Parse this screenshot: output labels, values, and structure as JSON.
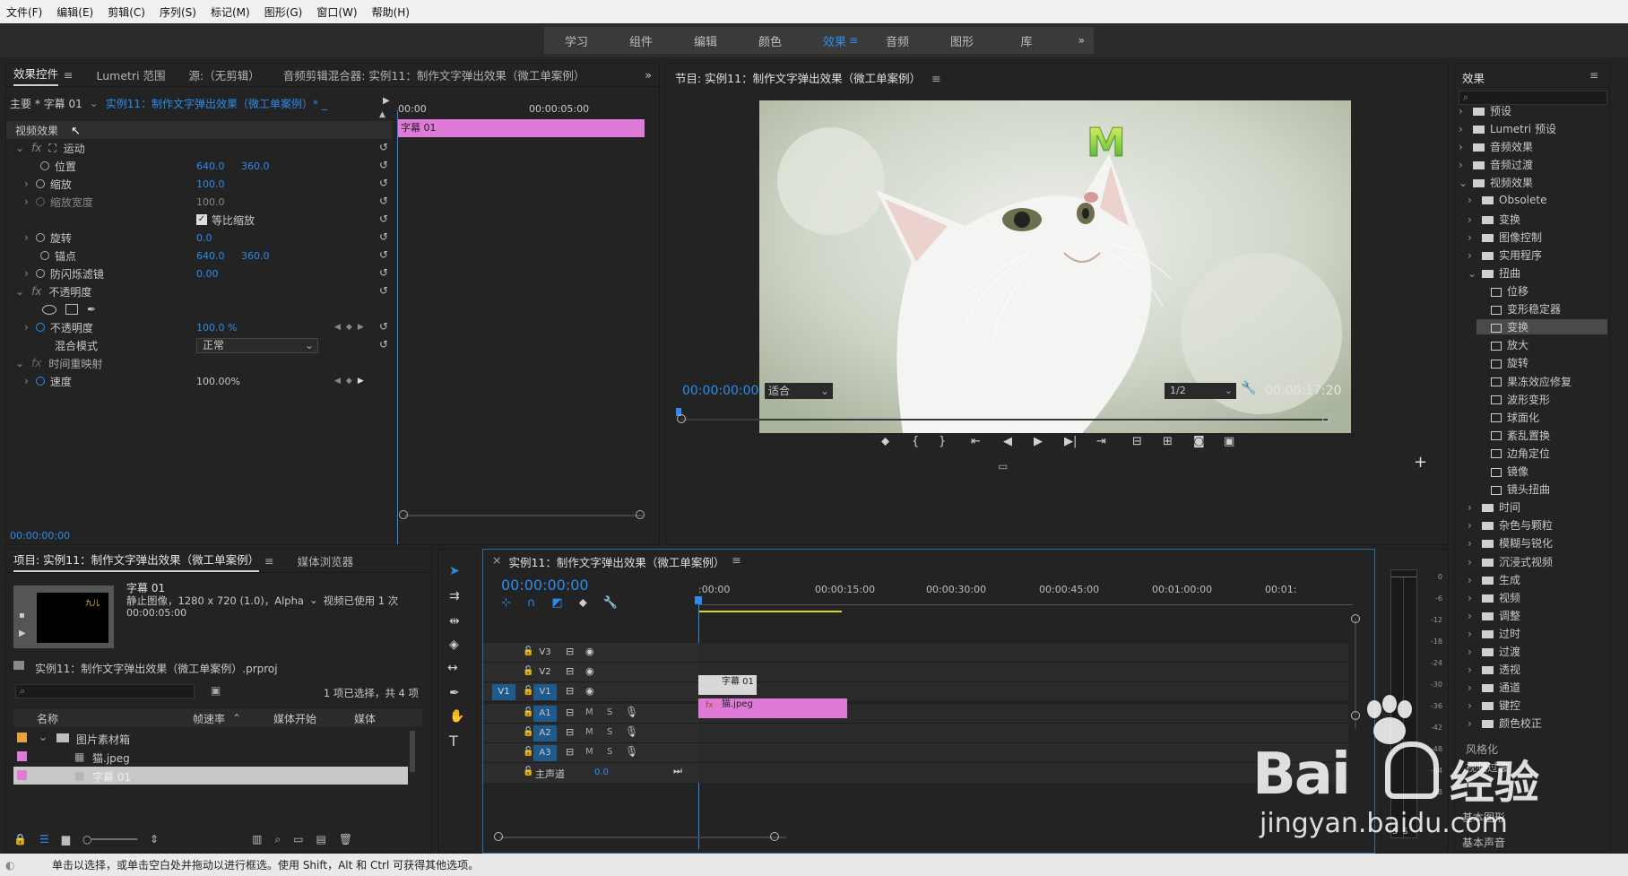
{
  "menubar": [
    "文件(F)",
    "编辑(E)",
    "剪辑(C)",
    "序列(S)",
    "标记(M)",
    "图形(G)",
    "窗口(W)",
    "帮助(H)"
  ],
  "workspaces": {
    "items": [
      "学习",
      "组件",
      "编辑",
      "颜色",
      "效果",
      "音频",
      "图形",
      "库"
    ],
    "active": "效果",
    "more": "»"
  },
  "effect_controls": {
    "tabs": [
      "效果控件",
      "Lumetri 范围",
      "源:（无剪辑）",
      "音频剪辑混合器: 实例11：制作文字弹出效果（微工单案例）"
    ],
    "master_label": "主要 * 字幕 01",
    "sequence_label": "实例11：制作文字弹出效果（微工单案例）* _",
    "ruler_start": "00:00",
    "ruler_end": "00:00:05:00",
    "clip_label": "字幕 01",
    "section": "视频效果",
    "motion": "运动",
    "position_label": "位置",
    "position_x": "640.0",
    "position_y": "360.0",
    "scale_label": "缩放",
    "scale_value": "100.0",
    "scale_width_label": "缩放宽度",
    "scale_width_value": "100.0",
    "uniform_label": "等比缩放",
    "rotation_label": "旋转",
    "rotation_value": "0.0",
    "anchor_label": "锚点",
    "anchor_x": "640.0",
    "anchor_y": "360.0",
    "flicker_label": "防闪烁滤镜",
    "flicker_value": "0.00",
    "opacity_section": "不透明度",
    "opacity_label": "不透明度",
    "opacity_value": "100.0 %",
    "blend_label": "混合模式",
    "blend_value": "正常",
    "time_remap": "时间重映射",
    "speed_label": "速度",
    "speed_value": "100.00%",
    "timecode": "00:00:00:00"
  },
  "program": {
    "title": "节目: 实例11：制作文字弹出效果（微工单案例）",
    "overlay_letter": "M",
    "timecode": "00:00:00:00",
    "fit": "适合",
    "resolution": "1/2",
    "duration": "00:00:17:20"
  },
  "effects": {
    "title": "效果",
    "search_placeholder": "",
    "items": [
      {
        "label": "预设",
        "level": 0,
        "kind": "preset-folder",
        "open": false
      },
      {
        "label": "Lumetri 预设",
        "level": 0,
        "kind": "preset-folder",
        "open": false
      },
      {
        "label": "音频效果",
        "level": 0,
        "kind": "folder",
        "open": false
      },
      {
        "label": "音频过渡",
        "level": 0,
        "kind": "folder",
        "open": false
      },
      {
        "label": "视频效果",
        "level": 0,
        "kind": "folder",
        "open": true
      },
      {
        "label": "Obsolete",
        "level": 1,
        "kind": "folder",
        "open": false
      },
      {
        "label": "变换",
        "level": 1,
        "kind": "folder",
        "open": false
      },
      {
        "label": "图像控制",
        "level": 1,
        "kind": "folder",
        "open": false
      },
      {
        "label": "实用程序",
        "level": 1,
        "kind": "folder",
        "open": false
      },
      {
        "label": "扭曲",
        "level": 1,
        "kind": "folder",
        "open": true
      },
      {
        "label": "位移",
        "level": 2,
        "kind": "preset"
      },
      {
        "label": "变形稳定器",
        "level": 2,
        "kind": "preset"
      },
      {
        "label": "变换",
        "level": 2,
        "kind": "preset",
        "selected": true
      },
      {
        "label": "放大",
        "level": 2,
        "kind": "preset"
      },
      {
        "label": "旋转",
        "level": 2,
        "kind": "preset"
      },
      {
        "label": "果冻效应修复",
        "level": 2,
        "kind": "preset"
      },
      {
        "label": "波形变形",
        "level": 2,
        "kind": "preset"
      },
      {
        "label": "球面化",
        "level": 2,
        "kind": "preset"
      },
      {
        "label": "紊乱置换",
        "level": 2,
        "kind": "preset"
      },
      {
        "label": "边角定位",
        "level": 2,
        "kind": "preset"
      },
      {
        "label": "镜像",
        "level": 2,
        "kind": "preset"
      },
      {
        "label": "镜头扭曲",
        "level": 2,
        "kind": "preset"
      },
      {
        "label": "时间",
        "level": 1,
        "kind": "folder",
        "open": false
      },
      {
        "label": "杂色与颗粒",
        "level": 1,
        "kind": "folder",
        "open": false
      },
      {
        "label": "模糊与锐化",
        "level": 1,
        "kind": "folder",
        "open": false
      },
      {
        "label": "沉浸式视频",
        "level": 1,
        "kind": "folder",
        "open": false
      },
      {
        "label": "生成",
        "level": 1,
        "kind": "folder",
        "open": false
      },
      {
        "label": "视频",
        "level": 1,
        "kind": "folder",
        "open": false
      },
      {
        "label": "调整",
        "level": 1,
        "kind": "folder",
        "open": false
      },
      {
        "label": "过时",
        "level": 1,
        "kind": "folder",
        "open": false
      },
      {
        "label": "过渡",
        "level": 1,
        "kind": "folder",
        "open": false
      },
      {
        "label": "透视",
        "level": 1,
        "kind": "folder",
        "open": false
      },
      {
        "label": "通道",
        "level": 1,
        "kind": "folder",
        "open": false
      },
      {
        "label": "键控",
        "level": 1,
        "kind": "folder",
        "open": false
      },
      {
        "label": "颜色校正",
        "level": 1,
        "kind": "folder",
        "open": false
      }
    ],
    "partial1": "风格化",
    "partial2": "视频过渡",
    "bottom1": "基本图形",
    "bottom2": "基本声音"
  },
  "project": {
    "tabs": [
      "项目: 实例11：制作文字弹出效果（微工单案例）",
      "媒体浏览器"
    ],
    "clip_name": "字幕 01",
    "clip_info": "静止图像，1280 x 720 (1.0)，Alpha",
    "clip_usage": "视频已使用 1 次",
    "clip_duration": "00:00:05:00",
    "thumb_text": "九儿",
    "project_file": "实例11：制作文字弹出效果（微工单案例）.prproj",
    "selection_info": "1 项已选择，共 4 项",
    "columns": [
      "名称",
      "帧速率",
      "媒体开始",
      "媒体"
    ],
    "rows": [
      {
        "label": "图片素材箱",
        "color": "#e8a33c",
        "kind": "bin"
      },
      {
        "label": "猫.jpeg",
        "color": "#e07ad8",
        "kind": "file"
      },
      {
        "label": "字幕 01",
        "color": "#e07ad8",
        "kind": "file",
        "selected": true
      }
    ]
  },
  "timeline": {
    "title": "实例11：制作文字弹出效果（微工单案例）",
    "timecode": "00:00:00:00",
    "ruler": [
      ":00:00",
      "00:00:15:00",
      "00:00:30:00",
      "00:00:45:00",
      "00:01:00:00",
      "00:01:"
    ],
    "video_tracks": [
      "V3",
      "V2",
      "V1"
    ],
    "audio_tracks": [
      "A1",
      "A2",
      "A3"
    ],
    "source_patch": "V1",
    "track_m": "M",
    "track_s": "S",
    "master_label": "主声道",
    "master_value": "0.0",
    "clip_title": "字幕 01",
    "clip_image": "猫.jpeg"
  },
  "meter": {
    "labels": [
      "0",
      "-6",
      "-12",
      "-18",
      "-24",
      "-30",
      "-36",
      "-42",
      "-48",
      "-54",
      "dB"
    ],
    "solo": "S"
  },
  "watermark": {
    "brand": "Bai",
    "brand_cn": "经验",
    "url": "jingyan.baidu.com"
  },
  "status": "单击以选择，或单击空白处并拖动以进行框选。使用 Shift，Alt 和 Ctrl 可获得其他选项。"
}
